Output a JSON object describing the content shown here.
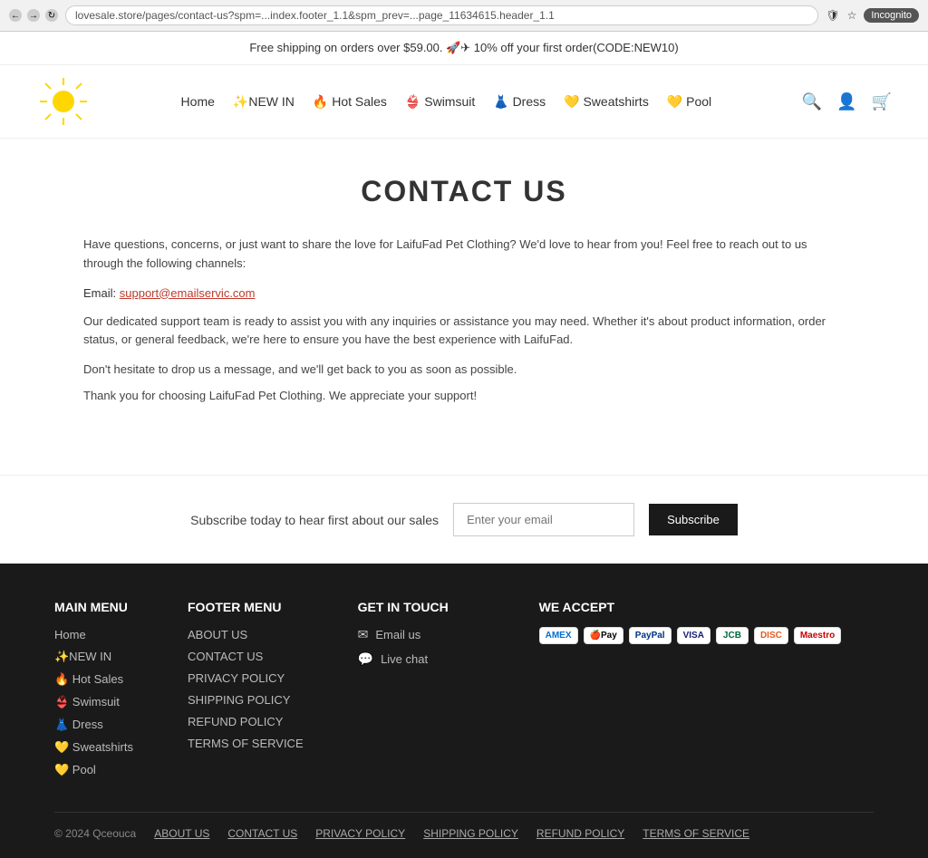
{
  "browser": {
    "url": "lovesale.store/pages/contact-us?spm=...index.footer_1.1&spm_prev=...page_11634615.header_1.1",
    "incognito": "Incognito"
  },
  "announcement": {
    "text": "Free shipping on orders over $59.00. 🚀✈ 10% off your first order(CODE:NEW10)"
  },
  "header": {
    "nav": [
      {
        "label": "Home",
        "href": "#"
      },
      {
        "label": "✨NEW IN",
        "href": "#"
      },
      {
        "label": "🔥 Hot Sales",
        "href": "#"
      },
      {
        "label": "👙 Swimsuit",
        "href": "#"
      },
      {
        "label": "👗 Dress",
        "href": "#"
      },
      {
        "label": "💛 Sweatshirts",
        "href": "#"
      },
      {
        "label": "💛 Pool",
        "href": "#"
      }
    ]
  },
  "main": {
    "page_title": "CONTACT US",
    "intro": "Have questions, concerns, or just want to share the love for LaifuFad Pet Clothing? We'd love to hear from you! Feel free to reach out to us through the following channels:",
    "email_label": "Email:",
    "email_address": "support@emailservic.com",
    "body_text": "Our dedicated support team is ready to assist you with any inquiries or assistance you may need. Whether it's about product information, order status, or general feedback, we're here to ensure you have the best experience with LaifuFad.",
    "note_text": "Don't hesitate to drop us a message, and we'll get back to you as soon as possible.",
    "thanks_text": "Thank you for choosing LaifuFad Pet Clothing. We appreciate your support!"
  },
  "subscribe": {
    "label": "Subscribe today to hear first about our sales",
    "placeholder": "Enter your email",
    "button_label": "Subscribe"
  },
  "footer": {
    "main_menu": {
      "title": "MAIN MENU",
      "items": [
        {
          "label": "Home"
        },
        {
          "label": "✨NEW IN"
        },
        {
          "label": "🔥 Hot Sales"
        },
        {
          "label": "👙 Swimsuit"
        },
        {
          "label": "👗 Dress"
        },
        {
          "label": "💛 Sweatshirts"
        },
        {
          "label": "💛 Pool"
        }
      ]
    },
    "footer_menu": {
      "title": "Footer menu",
      "items": [
        {
          "label": "ABOUT US"
        },
        {
          "label": "CONTACT US"
        },
        {
          "label": "PRIVACY POLICY"
        },
        {
          "label": "SHIPPING POLICY"
        },
        {
          "label": "REFUND POLICY"
        },
        {
          "label": "TERMS OF SERVICE"
        }
      ]
    },
    "get_in_touch": {
      "title": "Get in touch",
      "email_label": "Email us",
      "live_chat_label": "Live chat"
    },
    "we_accept": {
      "title": "We accept",
      "cards": [
        "AMEX",
        "Apple Pay",
        "PayPal",
        "VISA",
        "JCB",
        "DISCOVER",
        "Maestro"
      ]
    },
    "bottom": {
      "copyright": "© 2024 Qceouca",
      "links": [
        {
          "label": "ABOUT US"
        },
        {
          "label": "CONTACT US"
        },
        {
          "label": "PRIVACY POLICY"
        },
        {
          "label": "SHIPPING POLICY"
        },
        {
          "label": "REFUND POLICY"
        },
        {
          "label": "TERMS OF SERVICE"
        }
      ]
    }
  }
}
